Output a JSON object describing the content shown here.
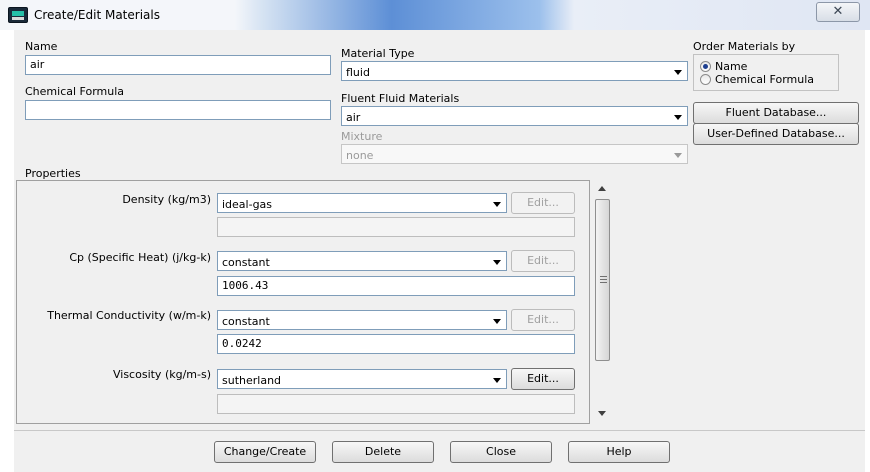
{
  "window": {
    "title": "Create/Edit Materials",
    "close_symbol": "✕"
  },
  "name": {
    "label": "Name",
    "value": "air"
  },
  "chemical_formula": {
    "label": "Chemical Formula",
    "value": ""
  },
  "material_type": {
    "label": "Material Type",
    "value": "fluid"
  },
  "fluent_fluid_materials": {
    "label": "Fluent Fluid Materials",
    "value": "air"
  },
  "mixture": {
    "label": "Mixture",
    "value": "none"
  },
  "order_by": {
    "label": "Order Materials by",
    "options": [
      {
        "label": "Name",
        "checked": true
      },
      {
        "label": "Chemical Formula",
        "checked": false
      }
    ]
  },
  "database_buttons": {
    "fluent_database": "Fluent Database...",
    "user_defined_database": "User-Defined Database..."
  },
  "properties": {
    "label": "Properties",
    "items": [
      {
        "label": "Density (kg/m3)",
        "method": "ideal-gas",
        "value": "",
        "edit_label": "Edit...",
        "edit_enabled": false
      },
      {
        "label": "Cp (Specific Heat) (j/kg-k)",
        "method": "constant",
        "value": "1006.43",
        "edit_label": "Edit...",
        "edit_enabled": false
      },
      {
        "label": "Thermal Conductivity (w/m-k)",
        "method": "constant",
        "value": "0.0242",
        "edit_label": "Edit...",
        "edit_enabled": false
      },
      {
        "label": "Viscosity (kg/m-s)",
        "method": "sutherland",
        "value": "",
        "edit_label": "Edit...",
        "edit_enabled": true
      }
    ]
  },
  "actions": {
    "change_create": "Change/Create",
    "delete": "Delete",
    "close": "Close",
    "help": "Help"
  },
  "colors": {
    "window_bg": "#f0f0f0",
    "field_border": "#7f9db9",
    "radio_selected": "#1e3f90",
    "titlebar_accent": "#5d8fd6"
  }
}
